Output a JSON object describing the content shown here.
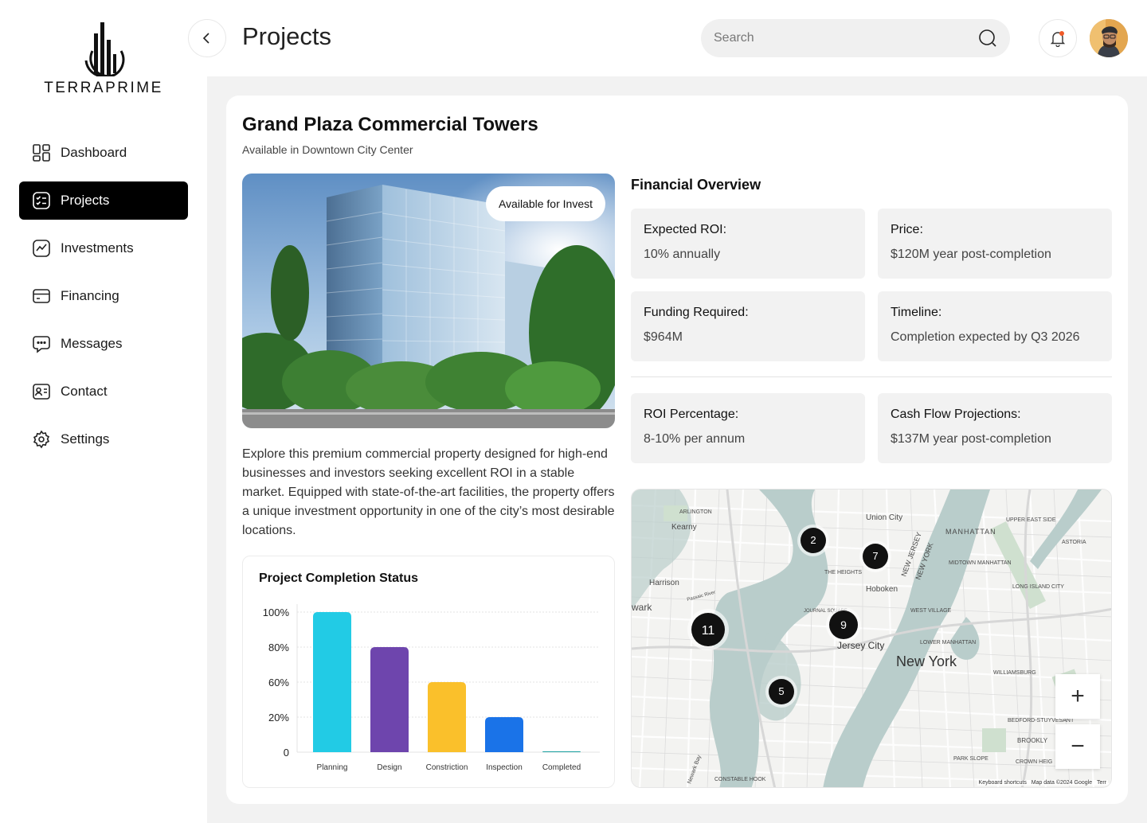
{
  "brand": {
    "name": "TERRAPRIME"
  },
  "nav": [
    {
      "label": "Dashboard",
      "icon": "dashboard-icon"
    },
    {
      "label": "Projects",
      "icon": "projects-icon",
      "active": true
    },
    {
      "label": "Investments",
      "icon": "investments-icon"
    },
    {
      "label": "Financing",
      "icon": "financing-icon"
    },
    {
      "label": "Messages",
      "icon": "messages-icon"
    },
    {
      "label": "Contact",
      "icon": "contact-icon"
    },
    {
      "label": "Settings",
      "icon": "settings-icon"
    }
  ],
  "header": {
    "title": "Projects",
    "search_placeholder": "Search"
  },
  "project": {
    "title": "Grand Plaza Commercial Towers",
    "subtitle": "Available in Downtown City Center",
    "badge": "Available for Invest",
    "description": "Explore this premium commercial property designed for high-end businesses and investors seeking excellent ROI in a stable market. Equipped with state-of-the-art facilities, the property offers a unique investment opportunity in one of the city’s most desirable locations."
  },
  "financial": {
    "title": "Financial Overview",
    "items": [
      {
        "label": "Expected ROI:",
        "value": "10% annually"
      },
      {
        "label": "Price:",
        "value": "$120M year post-completion"
      },
      {
        "label": "Funding Required:",
        "value": "$964M"
      },
      {
        "label": "Timeline:",
        "value": "Completion expected by Q3 2026"
      },
      {
        "label": "ROI Percentage:",
        "value": "8-10% per annum"
      },
      {
        "label": "Cash Flow Projections:",
        "value": "$137M year post-completion"
      }
    ]
  },
  "chart_data": {
    "type": "bar",
    "title": "Project Completion Status",
    "categories": [
      "Planning",
      "Design",
      "Constriction",
      "Inspection",
      "Completed"
    ],
    "values": [
      100,
      80,
      60,
      20,
      0
    ],
    "ytick_labels": [
      "0",
      "20%",
      "60%",
      "80%",
      "100%"
    ],
    "colors": [
      "#22cbe5",
      "#6e45ad",
      "#fac02b",
      "#1a73e8",
      "#1aa0a0"
    ],
    "xlabel": "",
    "ylabel": "",
    "grid": true
  },
  "map": {
    "cluster_counts": [
      "2",
      "7",
      "9",
      "11",
      "5"
    ],
    "labels": [
      "Union City",
      "Kearny",
      "ARLINGTON",
      "MANHATTAN",
      "UPPER EAST SIDE",
      "ASTORIA",
      "MIDTOWN MANHATTAN",
      "THE HEIGHTS",
      "Hoboken",
      "Harrison",
      "wark",
      "LONG ISLAND CITY",
      "WEST VILLAGE",
      "JOURNAL SQUARE",
      "Jersey City",
      "New York",
      "LOWER MANHATTAN",
      "WILLIAMSBURG",
      "BEDFORD-STUYVESANT",
      "BROOKLY",
      "PARK SLOPE",
      "CROWN HEIG",
      "CONSTABLE HOOK",
      "NEW JERSEY",
      "NEW YORK",
      "Passaic River",
      "Newark Bay"
    ],
    "zoom_in": "+",
    "zoom_out": "−",
    "footer_shortcuts": "Keyboard shortcuts",
    "footer_data": "Map data ©2024 Google",
    "footer_terms": "Terr"
  }
}
